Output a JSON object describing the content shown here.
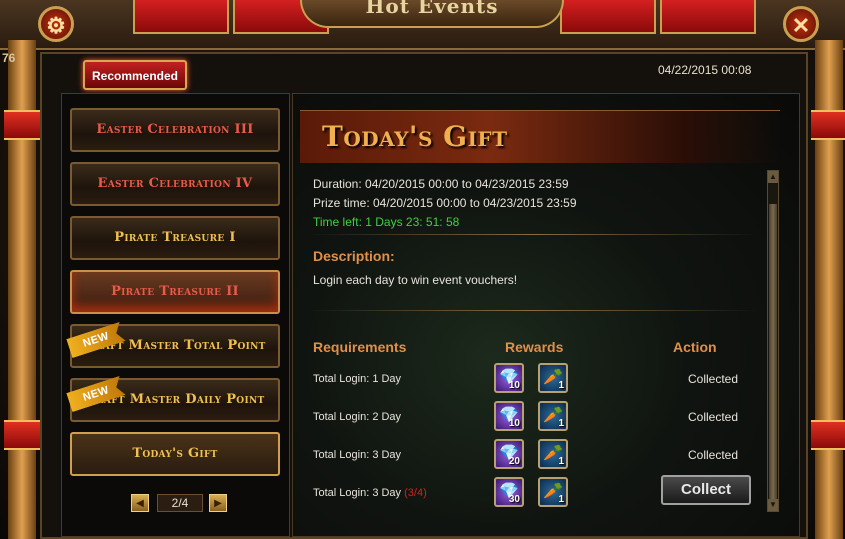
{
  "window": {
    "title": "Hot Events",
    "datetime": "04/22/2015 00:08",
    "side_number": "76"
  },
  "badge": {
    "recommended": "Recommended"
  },
  "menu": [
    {
      "label": "Easter Celebration III",
      "style": "red",
      "new": false
    },
    {
      "label": "Easter Celebration IV",
      "style": "red",
      "new": false
    },
    {
      "label": "Pirate Treasure I",
      "style": "gold",
      "new": false
    },
    {
      "label": "Pirate Treasure II",
      "style": "red",
      "new": false
    },
    {
      "label": "Craft Master Total Point",
      "style": "gold",
      "new": true
    },
    {
      "label": "Craft Master Daily Point",
      "style": "gold",
      "new": true
    },
    {
      "label": "Today's Gift",
      "style": "gold",
      "new": false
    }
  ],
  "new_tag": "NEW",
  "pager": {
    "text": "2/4",
    "prev_icon": "triangle-left-icon",
    "next_icon": "triangle-right-icon"
  },
  "event": {
    "title": "Today's Gift",
    "duration": "Duration: 04/20/2015 00:00 to 04/23/2015 23:59",
    "prize_time": "Prize time: 04/20/2015 00:00 to 04/23/2015 23:59",
    "time_left": "Time left: 1 Days  23: 51: 58",
    "description_label": "Description:",
    "description": "Login each day to win event vouchers!"
  },
  "table": {
    "headers": {
      "requirements": "Requirements",
      "rewards": "Rewards",
      "action": "Action"
    },
    "rows": [
      {
        "requirement": "Total Login: 1 Day",
        "progress": "",
        "crystal_qty": "10",
        "carrot_qty": "1",
        "action": "Collected"
      },
      {
        "requirement": "Total Login: 2 Day",
        "progress": "",
        "crystal_qty": "10",
        "carrot_qty": "1",
        "action": "Collected"
      },
      {
        "requirement": "Total Login: 3 Day",
        "progress": "",
        "crystal_qty": "20",
        "carrot_qty": "1",
        "action": "Collected"
      },
      {
        "requirement": "Total Login: 3 Day",
        "progress": "(3/4)",
        "crystal_qty": "30",
        "carrot_qty": "1",
        "action": "Collect"
      }
    ]
  },
  "colors": {
    "accent_gold": "#f0c050",
    "accent_red": "#e85a4a",
    "time_green": "#40d040",
    "progress_red": "#d02020"
  }
}
